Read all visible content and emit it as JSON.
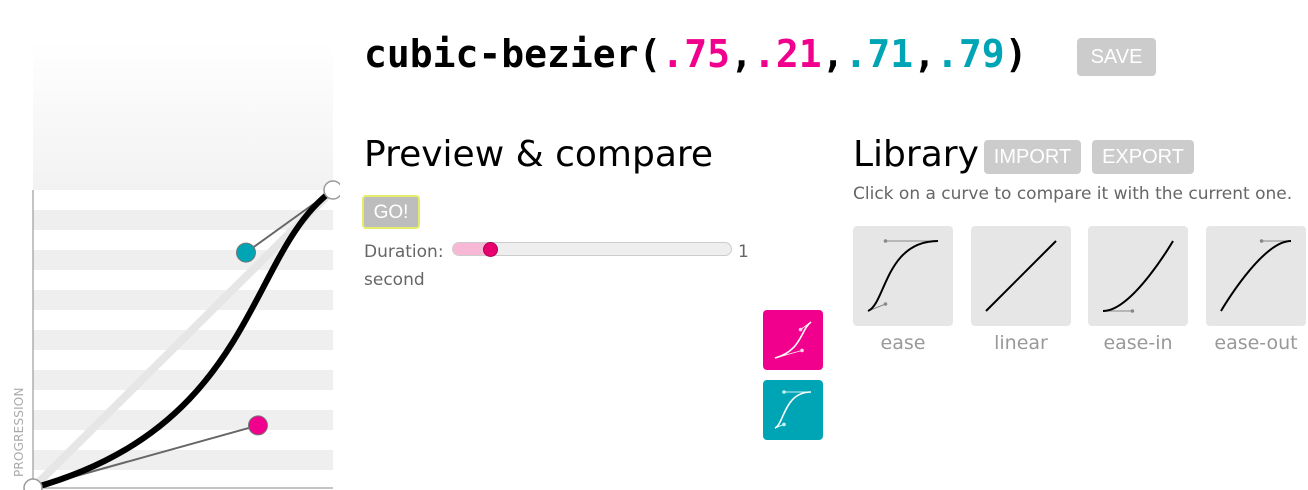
{
  "editor": {
    "axis_label": "PROGRESSION",
    "p1": [
      0.75,
      0.21
    ],
    "p2": [
      0.71,
      0.79
    ],
    "p1_color": "#f0008c",
    "p2_color": "#00a5b5"
  },
  "header": {
    "prefix": "cubic-bezier(",
    "v1": ".75",
    "v2": ".21",
    "v3": ".71",
    "v4": ".79",
    "suffix": ")",
    "comma": ",",
    "save_label": "SAVE"
  },
  "preview": {
    "title": "Preview & compare",
    "go_label": "GO!",
    "duration_label": "Duration:",
    "duration_value": "1",
    "duration_unit": "second",
    "duration_fraction": 0.12
  },
  "library": {
    "title": "Library",
    "import_label": "IMPORT",
    "export_label": "EXPORT",
    "description": "Click on a curve to compare it with the current one.",
    "curves": [
      {
        "label": "ease",
        "p": [
          0.25,
          0.1,
          0.25,
          1
        ]
      },
      {
        "label": "linear",
        "p": [
          0,
          0,
          1,
          1
        ]
      },
      {
        "label": "ease-in",
        "p": [
          0.42,
          0,
          1,
          1
        ]
      },
      {
        "label": "ease-out",
        "p": [
          0,
          0,
          0.58,
          1
        ]
      }
    ]
  }
}
